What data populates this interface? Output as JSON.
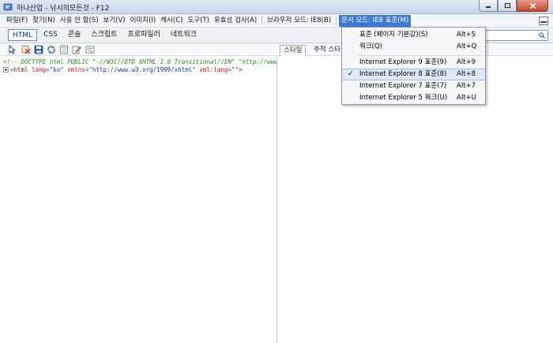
{
  "window": {
    "title": "하나산업 - 낚시의모든것 - F12"
  },
  "menubar": {
    "items": [
      {
        "label": "파일(F)"
      },
      {
        "label": "찾기(N)"
      },
      {
        "label": "사용 안 함(S)"
      },
      {
        "label": "보기(V)"
      },
      {
        "label": "이미지(I)"
      },
      {
        "label": "캐시(C)"
      },
      {
        "label": "도구(T)"
      },
      {
        "label": "유효성 검사(A)"
      }
    ],
    "browser_mode": "브라우저 모드: IE8(B)",
    "document_mode": "문서 모드: IE8 표준(M)"
  },
  "tabs": [
    {
      "label": "HTML"
    },
    {
      "label": "CSS"
    },
    {
      "label": "콘솔"
    },
    {
      "label": "스크립트"
    },
    {
      "label": "프로파일러"
    },
    {
      "label": "네트워크"
    }
  ],
  "right_tabs": [
    {
      "label": "스타일"
    },
    {
      "label": "추적 스타"
    }
  ],
  "code": {
    "line1": "<!-- DOCTYPE html PUBLIC \"-//W3C//DTD XHTML 1.0 Transitional//EN\" \"http://www.w",
    "line2": {
      "open": "<",
      "tag": "html",
      "attr1": "lang",
      "eq1": "=",
      "val1": "\"ko\"",
      "attr2": "xmlns",
      "eq2": "=",
      "val2": "\"http://www.w3.org/1999/xhtml\"",
      "attr3": "xml:lang",
      "eq3": "=",
      "val3": "\"\"",
      "close": ">"
    }
  },
  "dropdown": {
    "items": [
      {
        "label": "표준 (페이지 기본값)(S)",
        "accel": "Alt+S"
      },
      {
        "label": "쿼크(Q)",
        "accel": "Alt+Q"
      },
      {
        "label": "Internet Explorer 9 표준(9)",
        "accel": "Alt+9"
      },
      {
        "label": "Internet Explorer 8 표준(8)",
        "accel": "Alt+8"
      },
      {
        "label": "Internet Explorer 7 표준(7)",
        "accel": "Alt+7"
      },
      {
        "label": "Internet Explorer 5 쿼크(U)",
        "accel": "Alt+U"
      }
    ],
    "check_mark": "✓"
  },
  "colors": {
    "menu_active": "#3a7bd5",
    "tab_active_text": "#0b3a86",
    "comment": "#1f8a1f",
    "tag": "#7a1010",
    "attr": "#d01010",
    "value": "#1030c0"
  },
  "icons": {
    "select": "cursor-arrow-icon",
    "clear": "clear-highlight-icon",
    "save": "save-icon",
    "refresh": "refresh-icon",
    "dom": "dom-tree-icon",
    "edit": "edit-icon",
    "word_wrap": "word-wrap-icon",
    "search": "magnifier-icon"
  }
}
